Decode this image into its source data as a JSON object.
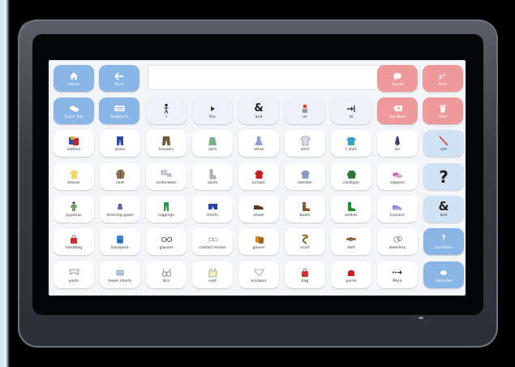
{
  "toolbar": {
    "home": "Home",
    "back": "Back",
    "quick_talk": "Quick Talk",
    "keyboard": "Keyboard",
    "speak": "Speak",
    "rest": "Rest",
    "del_word": "Del Word",
    "clear": "Clear",
    "message": ""
  },
  "core_words": [
    "I",
    "the",
    "and",
    "on",
    "to"
  ],
  "rows": [
    [
      "clothes",
      "jeans",
      "trousers",
      "skirt",
      "dress",
      "shirt",
      "t shirt",
      "tie",
      "not"
    ],
    [
      "blouse",
      "coat",
      "underwear",
      "socks",
      "jumper",
      "sweater",
      "cardigan",
      "slippers",
      ""
    ],
    [
      "pyjamas",
      "dressing gown",
      "leggings",
      "shorts",
      "shoes",
      "boots",
      "wellies",
      "trainers",
      "and"
    ],
    [
      "handbag",
      "backpack",
      "glasses",
      "contact lenses",
      "gloves",
      "scarf",
      "belt",
      "jewellery",
      "Questions"
    ],
    [
      "pants",
      "boxer shorts",
      "bra",
      "vest",
      "knickers",
      "bag",
      "purse",
      "More",
      "Describe"
    ]
  ],
  "big_symbols": {
    "question": "?",
    "ampersand": "&"
  },
  "colors": {
    "accent_blue": "#8ab6e6",
    "accent_pink": "#ee9a9a",
    "side_blue": "#cfe3f4"
  }
}
